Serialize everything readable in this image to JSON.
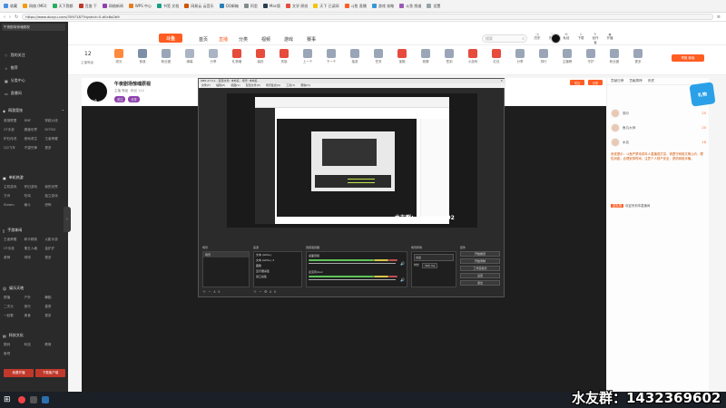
{
  "browser": {
    "url": "https://www.douyu.com/3597187?dyshid=0-d0c8a2b9",
    "tab_label": "午夜剧场惊魂原视",
    "bookmarks": [
      "收藏",
      "网络 (MEI)",
      "天下我都",
      "百度·下",
      "网络新闻",
      "WPS 中心",
      "书签 文档",
      "网易云 云音乐",
      "QQ邮箱",
      "阿里",
      "Mac版",
      "文学 原创",
      "天下 已读网",
      "斗鱼 直播",
      "游戏 攻略",
      "斗鱼 频道",
      "设置",
      "更多"
    ]
  },
  "sidebar": {
    "tabs": [
      "我的关注",
      "推荐",
      "分类中心",
      "直播间"
    ],
    "sections": [
      {
        "title": "网游竞技",
        "items": [
          "英雄联盟",
          "DNF",
          "穿越火线",
          "CF手游",
          "魔兽世界",
          "DOTA2",
          "炉石传说",
          "绝地求生",
          "王者荣耀",
          "QQ飞车",
          "守望先锋",
          "更多"
        ]
      },
      {
        "title": "单机热游",
        "items": [
          "主机游戏",
          "怀旧游戏",
          "我的世界",
          "方舟",
          "吃鸡",
          "独立游戏",
          "Steam",
          "格斗",
          "恐怖"
        ]
      },
      {
        "title": "手游休闲",
        "items": [
          "王者荣耀",
          "和平精英",
          "火影手游",
          "CF手游",
          "第五人格",
          "金铲铲",
          "原神",
          "球球",
          "更多"
        ]
      },
      {
        "title": "娱乐天地",
        "items": [
          "颜值",
          "户外",
          "舞蹈",
          "二次元",
          "音乐",
          "星秀",
          "一起看",
          "美食",
          "更多"
        ]
      },
      {
        "title": "科技文化",
        "items": [
          "数码",
          "科技",
          "教育",
          "鱼吧"
        ]
      }
    ],
    "open_live": "我要开播",
    "download": "下载客户端"
  },
  "topnav": {
    "logo": "斗鱼",
    "links": [
      "首页",
      "直播",
      "分类",
      "视频",
      "游戏",
      "赛事"
    ],
    "search_placeholder": "搜索",
    "icons": [
      "历史",
      "关注",
      "私信",
      "下载",
      "创作者",
      "开播"
    ]
  },
  "toolstrip": {
    "level": "12",
    "level_label": "主播等级",
    "tools": [
      "成长",
      "音浪",
      "粉丝团",
      "弹幕",
      "分享",
      "礼物墙",
      "装扮",
      "贵族",
      "上一个",
      "下一个",
      "抽奖",
      "任务",
      "宝箱",
      "竞猜",
      "签到",
      "小游戏",
      "红包",
      "分享",
      "排行",
      "主播榜",
      "守护",
      "粉丝团",
      "更多"
    ],
    "report_btn": "举报 新版"
  },
  "room": {
    "title": "午夜剧场惊魂原视",
    "tags": [
      "主播 等级",
      "粉丝 112",
      "关注",
      "分享"
    ],
    "avatar_text": "斗鱼",
    "follow": "关注"
  },
  "obs": {
    "title": "OBS 27.0.1 - 配置文件: 未命名 - 场景: 未命名",
    "menu": [
      "文件(F)",
      "编辑(E)",
      "视图(V)",
      "配置文件(P)",
      "场景集合(S)",
      "工具(T)",
      "帮助(H)"
    ],
    "scenes_header": "场景",
    "sources_header": "来源",
    "mixer_header": "音频混音器",
    "transitions_header": "场景转场",
    "controls_header": "控件",
    "scene_item": "场景",
    "sources": [
      "文本 (GDI+)",
      "文本 (GDI+) 2",
      "图像",
      "显示器采集",
      "窗口采集"
    ],
    "mixer_channels": [
      "桌面音频",
      "麦克风/Aux"
    ],
    "transition_value": "淡出",
    "duration_label": "时长",
    "duration_value": "300 ms",
    "controls": [
      "开始推流",
      "开始录制",
      "工作室模式",
      "设置",
      "退出"
    ]
  },
  "chat": {
    "tabs": [
      "贡献日榜",
      "贡献周榜",
      "贵宾"
    ],
    "badge": "礼物",
    "rows": [
      {
        "name": "观众",
        "level": "25"
      },
      {
        "name": "鱼丸大师",
        "level": "20"
      },
      {
        "name": "水友",
        "level": "18"
      }
    ],
    "notice": "系统提示：斗鱼严禁未成年人直播或打赏，请遵守网络文明公约，理性消费，合理安排时间，注意个人财产安全，谨防网络诈骗。",
    "announce": "欢迎来到本直播间",
    "sticker": "送礼物"
  },
  "watermark": "水友群：1432369602"
}
